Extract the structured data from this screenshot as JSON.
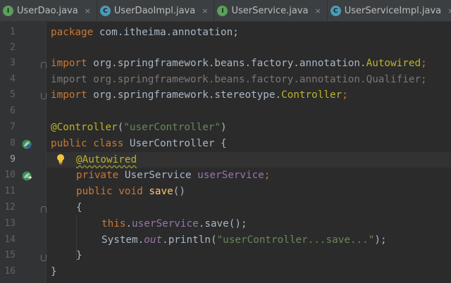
{
  "tabs": [
    {
      "label": "UserDao.java",
      "kind": "interface",
      "icon": "I",
      "close": "×"
    },
    {
      "label": "UserDaoImpl.java",
      "kind": "class",
      "icon": "C",
      "close": "×"
    },
    {
      "label": "UserService.java",
      "kind": "interface",
      "icon": "I",
      "close": "×"
    },
    {
      "label": "UserServiceImpl.java",
      "kind": "class",
      "icon": "C",
      "close": "×"
    },
    {
      "label": "",
      "kind": "class",
      "icon": "C",
      "close": ""
    }
  ],
  "line_numbers": [
    "1",
    "2",
    "3",
    "4",
    "5",
    "6",
    "7",
    "8",
    "9",
    "10",
    "11",
    "12",
    "13",
    "14",
    "15",
    "16"
  ],
  "current_line": 9,
  "code": {
    "l1": {
      "kw": "package",
      "rest": " com.itheima.annotation;"
    },
    "l3": {
      "kw": "import",
      "pkg": " org.springframework.beans.factory.annotation.",
      "cls": "Autowired",
      "end": ";"
    },
    "l4": {
      "text": "import org.springframework.beans.factory.annotation.Qualifier;"
    },
    "l5": {
      "kw": "import",
      "pkg": " org.springframework.stereotype.",
      "cls": "Controller",
      "end": ";"
    },
    "l7": {
      "ann": "@Controller",
      "open": "(",
      "str": "\"userController\"",
      "close": ")"
    },
    "l8": {
      "kw1": "public",
      "kw2": "class",
      "name": " UserController {"
    },
    "l9": {
      "ann": "@Autowired"
    },
    "l10": {
      "kw": "private",
      "type": " UserService ",
      "field": "userService",
      "end": ";"
    },
    "l11": {
      "kw1": "public",
      "kw2": "void",
      "fn": "save",
      "end": "()"
    },
    "l12": {
      "text": "{"
    },
    "l13": {
      "kw": "this",
      "dot": ".",
      "field": "userService",
      "rest": ".save();"
    },
    "l14": {
      "cls": "System",
      "dot": ".",
      "out": "out",
      "call": ".println(",
      "str": "\"userController...save...\"",
      "end": ");"
    },
    "l15": {
      "text": "}"
    },
    "l16": {
      "text": "}"
    }
  },
  "colors": {
    "keyword": "#cc7832",
    "annotation": "#bbb529",
    "string": "#6a8759",
    "field": "#9876aa",
    "method": "#ffc66d",
    "default": "#a9b7c6",
    "background": "#2b2b2b"
  },
  "icons": {
    "gutter_line8": "spring-bean-icon",
    "gutter_line10": "autowired-bean-icon",
    "editor_line9": "lightbulb-icon"
  }
}
